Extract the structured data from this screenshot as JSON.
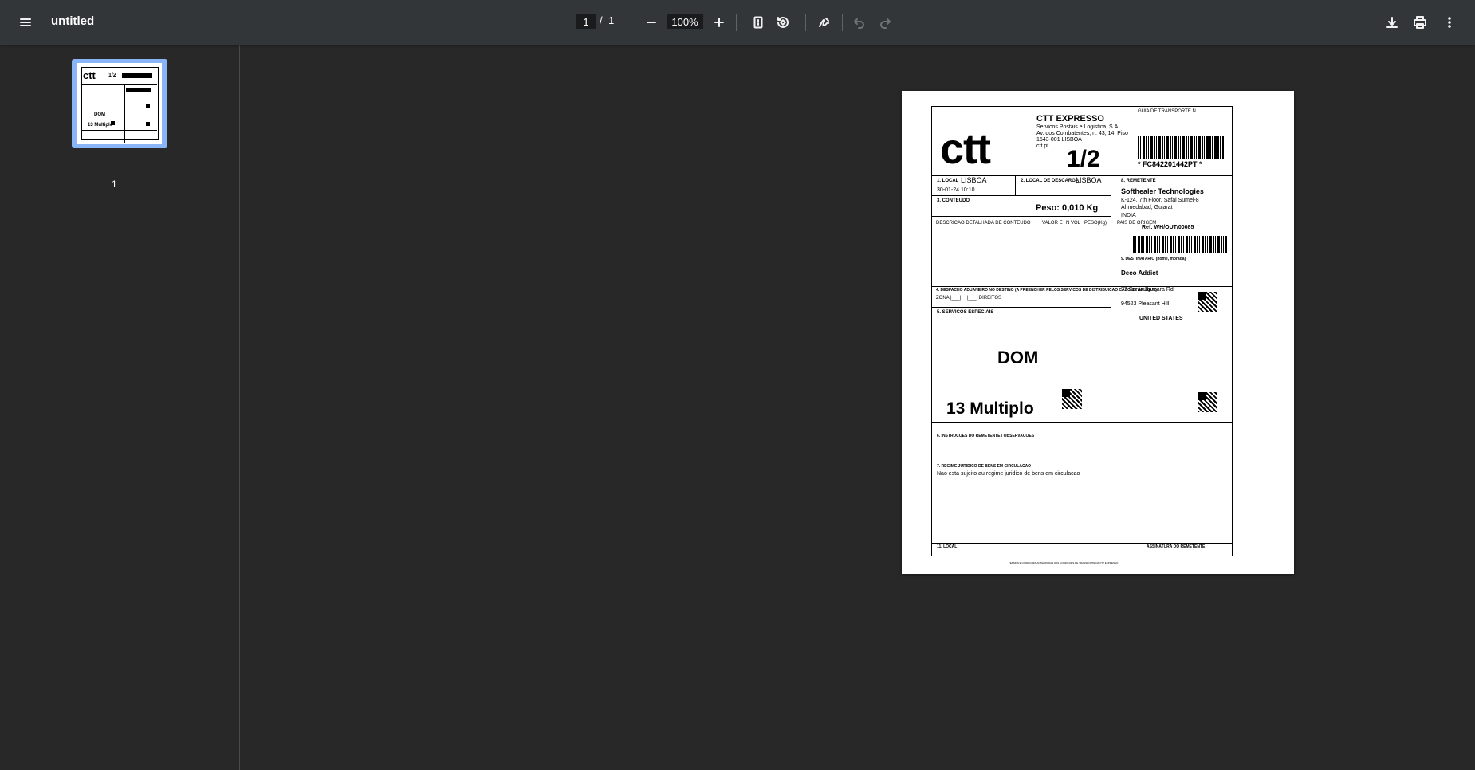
{
  "toolbar": {
    "title": "untitled",
    "page_current": "1",
    "page_separator": "/",
    "page_total": "1",
    "zoom": "100%",
    "icons": [
      "menu-icon",
      "zoom-out-icon",
      "zoom-in-icon",
      "fit-page-icon",
      "rotate-icon",
      "annotate-icon",
      "undo-icon",
      "redo-icon",
      "download-icon",
      "print-icon",
      "more-icon"
    ]
  },
  "sidebar": {
    "thumbnail_label": "1"
  },
  "label": {
    "logo": "ctt",
    "company": "CTT EXPRESSO",
    "company_line1": "Servicos Postais e Logistica, S.A.",
    "company_line2": "Av. dos Combatentes, n. 43, 14. Piso",
    "company_line3": "1543-001 LISBOA",
    "company_line4": "ctt.pt",
    "part": "1/2",
    "guia": "GUIA DE TRANSPORTE N",
    "tracking": "* FC842201442PT *",
    "local_aceitacao_label": "1. LOCAL",
    "local_aceitacao_value": "LISBOA",
    "datetime": "30-01-24 10:10",
    "local_descarga_label": "2. LOCAL DE DESCARGA",
    "local_descarga_value": "LISBOA",
    "conteudo_label": "3. CONTEUDO",
    "peso": "Peso: 0,010 Kg",
    "descricao_label": "DESCRICAO DETALHADA DE CONTEUDO",
    "valor_label": "VALOR E",
    "nvol_label": "N VOL",
    "peso_label": "PESO(Kg)",
    "pais_origem_label": "PAIS DE ORIGEM",
    "remetente_label": "8. REMETENTE",
    "remetente_name": "Softhealer Technologies",
    "remetente_addr1": "K-124, 7th Floor, Safal Sumel-8",
    "remetente_addr2": "Ahmedabad, Gujarat",
    "remetente_country": "INDIA",
    "ref": "Ref: WH/OUT/00085",
    "destinatario_label": "9. DESTINATARIO (nome, morada)",
    "destinatario_name": "Deco Addict",
    "destinatario_addr1": "77 Santa Barbara Rd",
    "destinatario_addr2": "94523 Pleasant Hill",
    "destinatario_country": "UNITED STATES",
    "despacho_label": "4. DESPACHO ADUANEIRO NO DESTINO (A PREENCHER PELOS SERVICOS DE DISTRIBUICAO CASO SE APLIQUE)",
    "zona_label": "ZONA |___|",
    "direitos_label": "|___|  DIREITOS",
    "servicos_label": "5. SERVICOS ESPECIAIS",
    "service_code": "DOM",
    "multiplo": "13 Multiplo",
    "instrucoes_label": "6. INSTRUCOES DO REMETENTE / OBSERVACOES",
    "regime_label": "7. REGIME JURIDICO DE BENS EM CIRCULACAO",
    "regime_value": "Nao esta sujeito au regime juridico de bens em circulacao",
    "local_label": "11. LOCAL",
    "assinatura_label": "ASSINATURA DO REMETENTE",
    "footer": "TERMOS E CONDICOES ANTECIPADAS DAS CONDICOES DE TRANSPORTE DA CTT EXPRESSO"
  }
}
